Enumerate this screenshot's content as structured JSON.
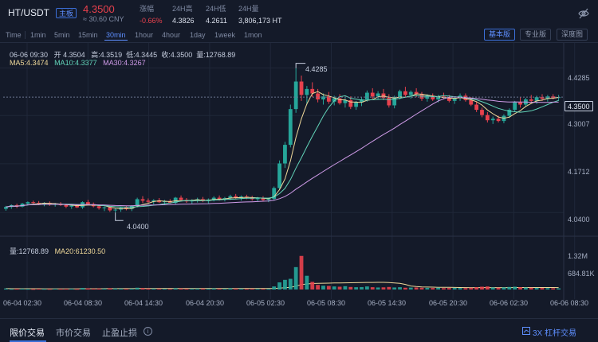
{
  "header": {
    "pair": "HT/USDT",
    "badge": "主板",
    "last_price": "4.3500",
    "cny": "≈ 30.60 CNY",
    "stats": [
      {
        "label": "涨幅",
        "value": "-0.66%"
      },
      {
        "label": "24H高",
        "value": "4.3826"
      },
      {
        "label": "24H低",
        "value": "4.2611"
      },
      {
        "label": "24H量",
        "value": "3,806,173 HT"
      }
    ]
  },
  "toolbar": {
    "timeframes": [
      "Time",
      "1min",
      "5min",
      "15min",
      "30min",
      "1hour",
      "4hour",
      "1day",
      "1week",
      "1mon"
    ],
    "active_timeframe": "30min",
    "views": [
      "基本版",
      "专业版",
      "深度图"
    ],
    "active_view": "基本版"
  },
  "ohlc": {
    "date": "06-06 09:30",
    "open": "开 4.3504",
    "high": "高:4.3519",
    "low": "低:4.3445",
    "close": "收:4.3500",
    "volume": "量:12768.89"
  },
  "ma": {
    "ma5": "MA5:4.3474",
    "ma10": "MA10:4.3377",
    "ma30": "MA30:4.3267"
  },
  "volume_info": {
    "vol": "量:12768.89",
    "ma20": "MA20:61230.50"
  },
  "price_axis": [
    "4.4285",
    "4.3500",
    "4.3007",
    "4.1712",
    "4.0400"
  ],
  "volume_axis": [
    "1.32M",
    "684.81K"
  ],
  "time_axis": [
    "06-04 02:30",
    "06-04 08:30",
    "06-04 14:30",
    "06-04 20:30",
    "06-05 02:30",
    "06-05 08:30",
    "06-05 14:30",
    "06-05 20:30",
    "06-06 02:30",
    "06-06 08:30"
  ],
  "annotations": {
    "high": "4.4285",
    "low": "4.0400"
  },
  "current_price": "4.3500",
  "footer": {
    "tabs": [
      "限价交易",
      "市价交易",
      "止盈止损"
    ],
    "active_tab": "限价交易",
    "leverage": "3X 杠杆交易"
  },
  "colors": {
    "up": "#26a69a",
    "down": "#e8414d",
    "accent": "#3b6fd8",
    "background": "#141a29"
  },
  "chart_data": {
    "type": "candlestick",
    "interval": "30min",
    "candles_ohlc": [
      [
        4.05,
        4.058,
        4.045,
        4.055
      ],
      [
        4.055,
        4.062,
        4.05,
        4.06
      ],
      [
        4.06,
        4.064,
        4.052,
        4.056
      ],
      [
        4.056,
        4.066,
        4.054,
        4.064
      ],
      [
        4.064,
        4.07,
        4.06,
        4.068
      ],
      [
        4.068,
        4.072,
        4.062,
        4.066
      ],
      [
        4.066,
        4.071,
        4.06,
        4.063
      ],
      [
        4.063,
        4.068,
        4.057,
        4.066
      ],
      [
        4.066,
        4.07,
        4.058,
        4.061
      ],
      [
        4.061,
        4.066,
        4.056,
        4.064
      ],
      [
        4.064,
        4.068,
        4.058,
        4.06
      ],
      [
        4.06,
        4.064,
        4.052,
        4.056
      ],
      [
        4.056,
        4.062,
        4.05,
        4.059
      ],
      [
        4.059,
        4.063,
        4.052,
        4.054
      ],
      [
        4.054,
        4.07,
        4.05,
        4.068
      ],
      [
        4.068,
        4.074,
        4.06,
        4.063
      ],
      [
        4.063,
        4.067,
        4.054,
        4.057
      ],
      [
        4.057,
        4.061,
        4.048,
        4.052
      ],
      [
        4.052,
        4.057,
        4.044,
        4.054
      ],
      [
        4.054,
        4.058,
        4.042,
        4.046
      ],
      [
        4.046,
        4.052,
        4.04,
        4.048
      ],
      [
        4.048,
        4.056,
        4.042,
        4.053
      ],
      [
        4.053,
        4.058,
        4.046,
        4.05
      ],
      [
        4.05,
        4.06,
        4.044,
        4.058
      ],
      [
        4.058,
        4.08,
        4.054,
        4.076
      ],
      [
        4.076,
        4.084,
        4.066,
        4.072
      ],
      [
        4.072,
        4.078,
        4.064,
        4.069
      ],
      [
        4.069,
        4.076,
        4.062,
        4.073
      ],
      [
        4.073,
        4.079,
        4.066,
        4.068
      ],
      [
        4.068,
        4.074,
        4.06,
        4.071
      ],
      [
        4.071,
        4.076,
        4.064,
        4.066
      ],
      [
        4.066,
        4.082,
        4.062,
        4.08
      ],
      [
        4.08,
        4.086,
        4.07,
        4.074
      ],
      [
        4.074,
        4.079,
        4.066,
        4.07
      ],
      [
        4.07,
        4.076,
        4.063,
        4.073
      ],
      [
        4.073,
        4.08,
        4.067,
        4.076
      ],
      [
        4.076,
        4.082,
        4.068,
        4.071
      ],
      [
        4.071,
        4.078,
        4.064,
        4.075
      ],
      [
        4.075,
        4.084,
        4.07,
        4.08
      ],
      [
        4.08,
        4.086,
        4.072,
        4.077
      ],
      [
        4.077,
        4.082,
        4.07,
        4.079
      ],
      [
        4.079,
        4.088,
        4.074,
        4.084
      ],
      [
        4.084,
        4.09,
        4.076,
        4.079
      ],
      [
        4.079,
        4.086,
        4.072,
        4.083
      ],
      [
        4.083,
        4.088,
        4.076,
        4.08
      ],
      [
        4.08,
        4.085,
        4.072,
        4.076
      ],
      [
        4.076,
        4.082,
        4.07,
        4.079
      ],
      [
        4.079,
        4.084,
        4.071,
        4.074
      ],
      [
        4.074,
        4.08,
        4.068,
        4.077
      ],
      [
        4.077,
        4.11,
        4.072,
        4.106
      ],
      [
        4.106,
        4.18,
        4.1,
        4.172
      ],
      [
        4.172,
        4.23,
        4.16,
        4.222
      ],
      [
        4.222,
        4.33,
        4.215,
        4.318
      ],
      [
        4.318,
        4.428,
        4.308,
        4.392
      ],
      [
        4.392,
        4.408,
        4.34,
        4.356
      ],
      [
        4.356,
        4.38,
        4.33,
        4.372
      ],
      [
        4.372,
        4.39,
        4.35,
        4.36
      ],
      [
        4.36,
        4.372,
        4.336,
        4.344
      ],
      [
        4.344,
        4.36,
        4.33,
        4.352
      ],
      [
        4.352,
        4.364,
        4.332,
        4.338
      ],
      [
        4.338,
        4.354,
        4.328,
        4.347
      ],
      [
        4.347,
        4.358,
        4.33,
        4.334
      ],
      [
        4.334,
        4.348,
        4.322,
        4.342
      ],
      [
        4.342,
        4.352,
        4.318,
        4.324
      ],
      [
        4.324,
        4.34,
        4.316,
        4.336
      ],
      [
        4.336,
        4.35,
        4.326,
        4.344
      ],
      [
        4.344,
        4.368,
        4.338,
        4.362
      ],
      [
        4.362,
        4.374,
        4.346,
        4.352
      ],
      [
        4.352,
        4.366,
        4.344,
        4.36
      ],
      [
        4.36,
        4.372,
        4.342,
        4.348
      ],
      [
        4.348,
        4.358,
        4.322,
        4.328
      ],
      [
        4.328,
        4.354,
        4.32,
        4.35
      ],
      [
        4.35,
        4.37,
        4.344,
        4.366
      ],
      [
        4.366,
        4.378,
        4.35,
        4.356
      ],
      [
        4.356,
        4.368,
        4.346,
        4.364
      ],
      [
        4.364,
        4.374,
        4.35,
        4.358
      ],
      [
        4.358,
        4.364,
        4.34,
        4.346
      ],
      [
        4.346,
        4.358,
        4.338,
        4.354
      ],
      [
        4.354,
        4.36,
        4.34,
        4.344
      ],
      [
        4.344,
        4.356,
        4.336,
        4.352
      ],
      [
        4.352,
        4.362,
        4.344,
        4.349
      ],
      [
        4.349,
        4.356,
        4.336,
        4.34
      ],
      [
        4.34,
        4.352,
        4.332,
        4.348
      ],
      [
        4.348,
        4.36,
        4.34,
        4.354
      ],
      [
        4.354,
        4.36,
        4.338,
        4.342
      ],
      [
        4.342,
        4.35,
        4.326,
        4.33
      ],
      [
        4.33,
        4.338,
        4.31,
        4.316
      ],
      [
        4.316,
        4.322,
        4.296,
        4.302
      ],
      [
        4.302,
        4.31,
        4.282,
        4.288
      ],
      [
        4.288,
        4.298,
        4.278,
        4.292
      ],
      [
        4.292,
        4.3,
        4.282,
        4.286
      ],
      [
        4.286,
        4.304,
        4.28,
        4.3
      ],
      [
        4.3,
        4.32,
        4.294,
        4.316
      ],
      [
        4.316,
        4.34,
        4.31,
        4.336
      ],
      [
        4.336,
        4.35,
        4.322,
        4.33
      ],
      [
        4.33,
        4.348,
        4.324,
        4.344
      ],
      [
        4.344,
        4.356,
        4.334,
        4.34
      ],
      [
        4.34,
        4.354,
        4.332,
        4.35
      ],
      [
        4.35,
        4.358,
        4.34,
        4.346
      ],
      [
        4.346,
        4.356,
        4.338,
        4.352
      ],
      [
        4.352,
        4.358,
        4.344,
        4.348
      ],
      [
        4.348,
        4.356,
        4.34,
        4.35
      ]
    ],
    "volumes": [
      40000,
      25000,
      30000,
      35000,
      28000,
      22000,
      30000,
      26000,
      24000,
      32000,
      28000,
      30000,
      34000,
      26000,
      60000,
      45000,
      35000,
      40000,
      38000,
      50000,
      42000,
      36000,
      30000,
      34000,
      70000,
      55000,
      40000,
      38000,
      36000,
      30000,
      28000,
      50000,
      42000,
      34000,
      36000,
      40000,
      38000,
      32000,
      45000,
      36000,
      34000,
      48000,
      40000,
      36000,
      30000,
      34000,
      32000,
      30000,
      28000,
      120000,
      280000,
      380000,
      420000,
      880000,
      1320000,
      540000,
      300000,
      180000,
      150000,
      140000,
      120000,
      110000,
      130000,
      100000,
      90000,
      95000,
      120000,
      90000,
      80000,
      85000,
      100000,
      80000,
      90000,
      70000,
      75000,
      80000,
      70000,
      65000,
      60000,
      70000,
      55000,
      60000,
      65000,
      60000,
      55000,
      70000,
      90000,
      110000,
      120000,
      80000,
      70000,
      85000,
      100000,
      110000,
      90000,
      80000,
      70000,
      65000,
      60000,
      55000,
      50000,
      45000
    ],
    "price_ylim": [
      4.0,
      4.47
    ],
    "volume_ylim": [
      0,
      1500000
    ],
    "ma_periods": [
      5,
      10,
      30
    ],
    "volume_ma_period": 20,
    "grid": true
  }
}
